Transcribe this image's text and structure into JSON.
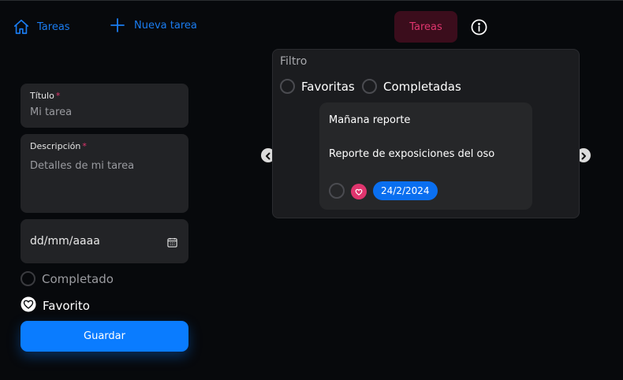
{
  "nav": {
    "home_label": "Tareas",
    "new_label": "Nueva tarea",
    "tab_label": "Tareas"
  },
  "form": {
    "title": {
      "label": "Título",
      "required_mark": "*",
      "value": "Mi tarea"
    },
    "description": {
      "label": "Descripción",
      "required_mark": "*",
      "value": "Detalles de mi tarea"
    },
    "date": {
      "value": "dd/mm/aaaa"
    },
    "completed_label": "Completado",
    "favorite_label": "Favorito",
    "save_label": "Guardar"
  },
  "filter": {
    "title": "Filtro",
    "options": [
      "Favoritas",
      "Completadas"
    ]
  },
  "task_card": {
    "title": "Mañana reporte",
    "description": "Reporte de exposiciones del oso",
    "date": "24/2/2024"
  },
  "colors": {
    "accent_blue": "#0a7cff",
    "accent_pink": "#e0356e",
    "background": "#07090c"
  }
}
